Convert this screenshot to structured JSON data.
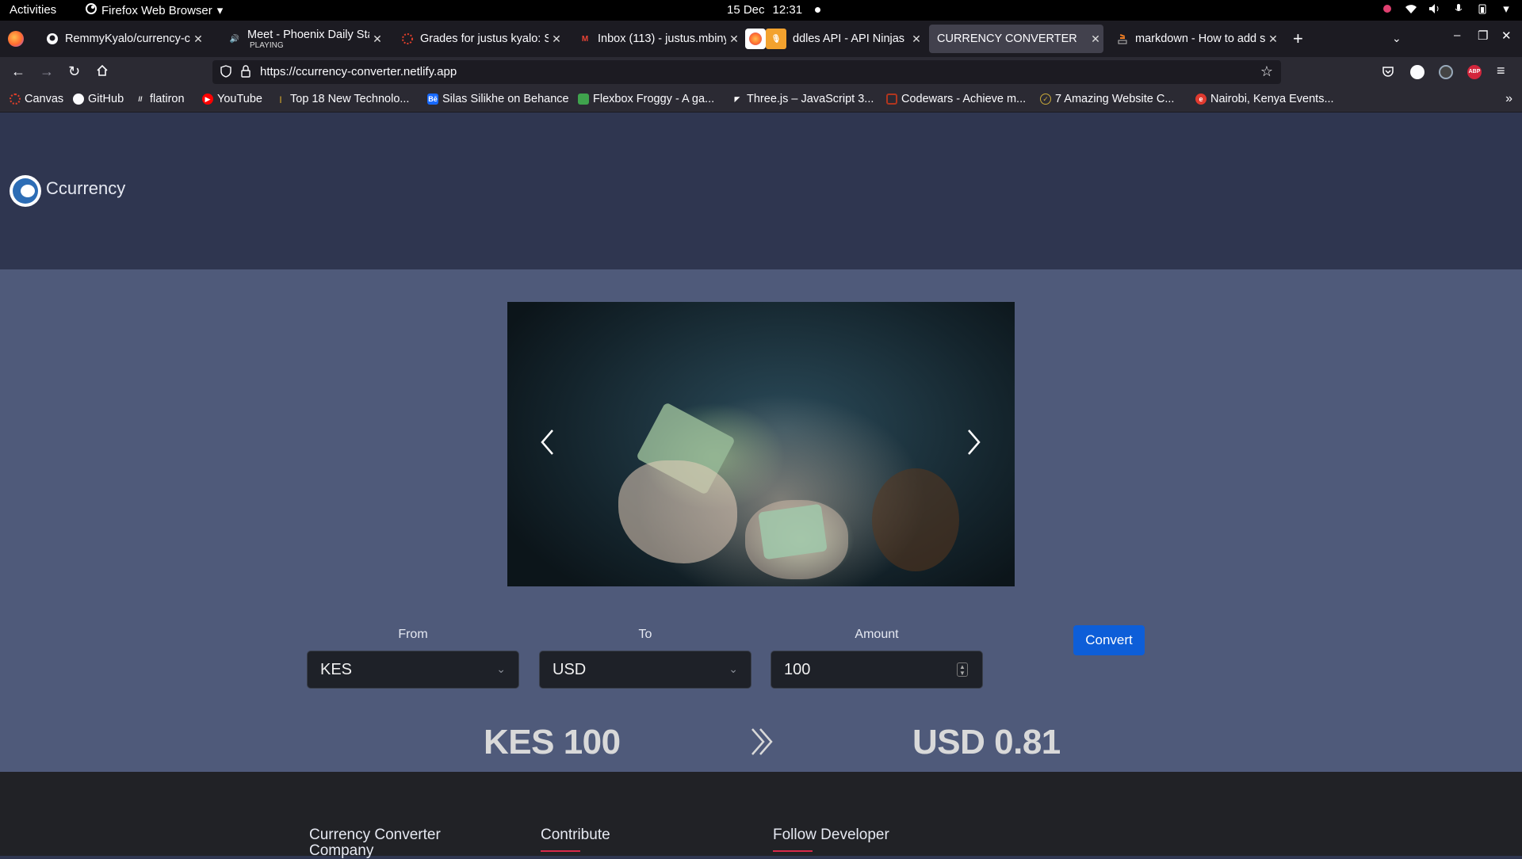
{
  "system": {
    "activities": "Activities",
    "app_menu": "Firefox Web Browser",
    "date": "15 Dec",
    "time": "12:31"
  },
  "browser": {
    "tabs": [
      {
        "title": "RemmyKyalo/currency-co",
        "favicon": "github-icon"
      },
      {
        "title": "Meet - Phoenix Daily Star",
        "subtitle": "PLAYING",
        "favicon": "speaker-icon"
      },
      {
        "title": "Grades for justus kyalo: S",
        "favicon": "canvas-icon"
      },
      {
        "title": "Inbox (113) - justus.mbiny",
        "favicon": "gmail-icon"
      },
      {
        "title": "ddles API - API Ninjas",
        "favicon": "firefox-icon"
      },
      {
        "title": "CURRENCY CONVERTER",
        "favicon": "none",
        "active": true
      },
      {
        "title": "markdown - How to add s",
        "favicon": "stackoverflow-icon"
      }
    ],
    "url": "https://ccurrency-converter.netlify.app",
    "bookmarks": [
      {
        "label": "Canvas"
      },
      {
        "label": "GitHub"
      },
      {
        "label": "flatiron"
      },
      {
        "label": "YouTube"
      },
      {
        "label": "Top 18 New Technolo..."
      },
      {
        "label": "Silas Silikhe on Behance"
      },
      {
        "label": "Flexbox Froggy - A ga..."
      },
      {
        "label": "Three.js – JavaScript 3..."
      },
      {
        "label": "Codewars - Achieve m..."
      },
      {
        "label": "7 Amazing Website C..."
      },
      {
        "label": "Nairobi, Kenya Events..."
      }
    ]
  },
  "site": {
    "brand": "Ccurrency",
    "form": {
      "from_label": "From",
      "from_value": "KES",
      "to_label": "To",
      "to_value": "USD",
      "amount_label": "Amount",
      "amount_value": "100",
      "convert_label": "Convert"
    },
    "result": {
      "source": "KES 100",
      "target": "USD 0.81"
    },
    "footer": {
      "col1": "Currency Converter Company",
      "col2": "Contribute",
      "col3": "Follow Developer"
    }
  },
  "colors": {
    "header_bg": "#2f3650",
    "body_bg": "#4f5a7a",
    "button": "#0d5ed8",
    "footer_bg": "#212226",
    "accent_underline": "#d9294a"
  }
}
